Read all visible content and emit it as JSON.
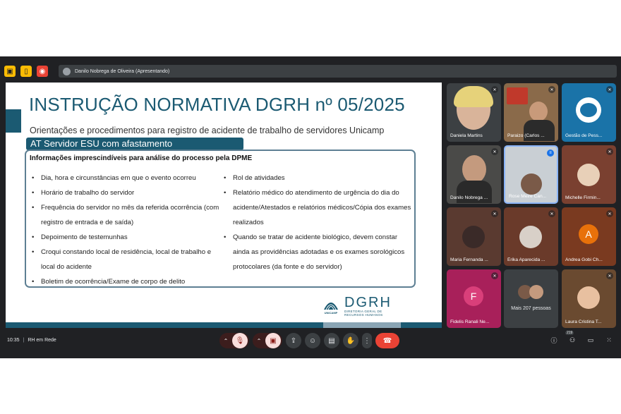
{
  "topbar": {
    "presenter": "Danilo Nobrega de Oliveira (Apresentando)",
    "icons": [
      "no-camera-icon",
      "phone-icon",
      "record-icon"
    ]
  },
  "slide": {
    "title": "INSTRUÇÃO NORMATIVA DGRH nº 05/2025",
    "subtitle": "Orientações e procedimentos para registro de acidente de trabalho de servidores Unicamp",
    "tag": "AT Servidor ESU com afastamento",
    "box_heading": "Informações imprescindíveis para análise do processo pela DPME",
    "col1": [
      "Dia, hora e circunstâncias em que o evento ocorreu",
      "Horário de trabalho do servidor",
      "Frequência do servidor no mês da referida ocorrência (com registro de entrada e de saída)",
      "Depoimento de testemunhas",
      "Croqui constando local de residência, local de trabalho e local do acidente",
      "Boletim de ocorrência/Exame de corpo de delito"
    ],
    "col2": [
      "Rol de atividades",
      "Relatório médico do atendimento de urgência do dia do acidente/Atestados e relatórios médicos/Cópia dos exames realizados",
      "Quando se tratar de acidente biológico, devem constar ainda as providências adotadas e os exames sorológicos protocolares (da fonte e do servidor)"
    ],
    "logo": {
      "unicamp": "UNICAMP",
      "dgrh": "DGRH",
      "dgrh_line1": "DIRETORIA GERAL DE",
      "dgrh_line2": "RECURSOS HUMANOS"
    }
  },
  "participants": [
    {
      "name": "Daniela Martins",
      "bg": "#8a7a6a"
    },
    {
      "name": "Paraizo (Carlos ...",
      "bg": "#6b5a4a"
    },
    {
      "name": "Gestão de Pess...",
      "bg": "#1a73a8"
    },
    {
      "name": "Danilo Nobrega ...",
      "bg": "#4a4a48"
    },
    {
      "name": "Rose Meire Can...",
      "bg": "#c9cfd4"
    },
    {
      "name": "Michelle Firmin...",
      "bg": "#7a4030"
    },
    {
      "name": "Maria Fernanda ...",
      "bg": "#5a3a30"
    },
    {
      "name": "Érika Aparecida ...",
      "bg": "#6a3a2a"
    },
    {
      "name": "Andrea Gobi Ch...",
      "bg": "#7a3a20",
      "letter": "A",
      "letter_bg": "#e8710a"
    },
    {
      "name": "Fidelis Ranali Ne...",
      "bg": "#a8205a",
      "letter": "F",
      "letter_bg": "#d93f7a"
    },
    {
      "name": "Mais 207 pessoas",
      "bg": "#3c4043"
    },
    {
      "name": "Laura Cristina T...",
      "bg": "#6a4a30"
    }
  ],
  "bottom": {
    "time": "10:35",
    "separator": "|",
    "meeting": "RH em Rede",
    "people_count": "219"
  }
}
